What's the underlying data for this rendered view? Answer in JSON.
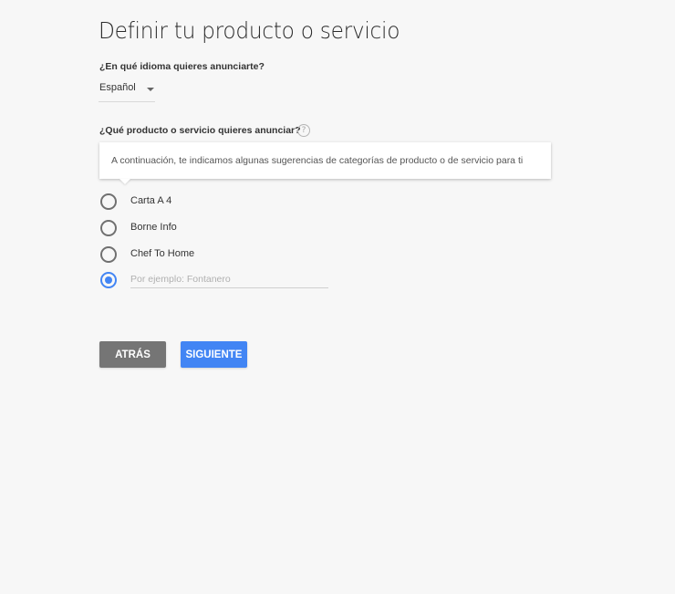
{
  "page": {
    "title": "Definir tu producto o servicio"
  },
  "language": {
    "label": "¿En qué idioma quieres anunciarte?",
    "selected": "Español"
  },
  "product": {
    "label": "¿Qué producto o servicio quieres anunciar?",
    "help_icon": "question-circle-icon",
    "help_glyph": "?",
    "tooltip": "A continuación, te indicamos algunas sugerencias de categorías de producto o de servicio para ti",
    "options": [
      {
        "label": "Carta A 4",
        "checked": false
      },
      {
        "label": "Borne Info",
        "checked": false
      },
      {
        "label": "Chef To Home",
        "checked": false
      }
    ],
    "custom_option": {
      "checked": true,
      "value": "",
      "placeholder": "Por ejemplo: Fontanero"
    }
  },
  "buttons": {
    "back": "ATRÁS",
    "next": "SIGUIENTE"
  },
  "colors": {
    "accent": "#4285f4",
    "back_button": "#757575",
    "background": "#f7f7f7"
  }
}
